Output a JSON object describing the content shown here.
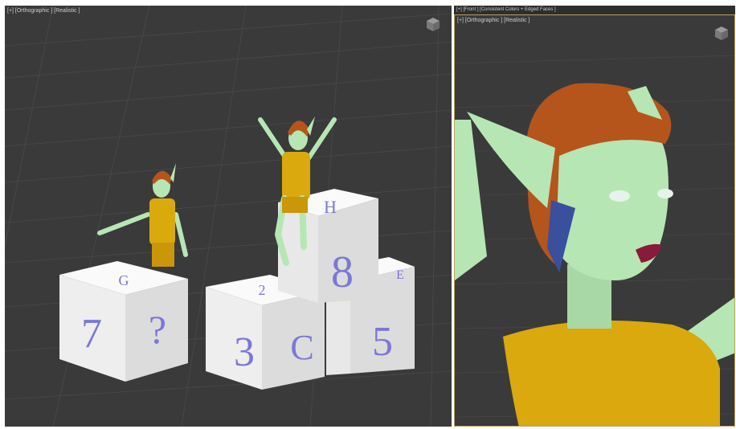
{
  "left_viewport": {
    "label": "[+] [Orthographic ] [Realistic ]",
    "cube_faces": [
      "7",
      "?",
      "3",
      "C",
      "8",
      "H",
      "5",
      "E",
      "G",
      "2"
    ],
    "viewcube_icon": "viewcube-icon"
  },
  "top_strip": {
    "label": "[+] [Front ] [Consistent Colors + Edged Faces ]"
  },
  "right_viewport": {
    "label": "[+] [Orthographic ] [Realistic ]",
    "viewcube_icon": "viewcube-icon"
  },
  "colors": {
    "viewport_bg": "#3a3a3a",
    "skin": "#b6e6b4",
    "hair": "#b5551c",
    "shirt": "#d9a90e",
    "cube": "#f2f2f2",
    "digit": "#7b78d6",
    "active_border": "#b8a060"
  }
}
